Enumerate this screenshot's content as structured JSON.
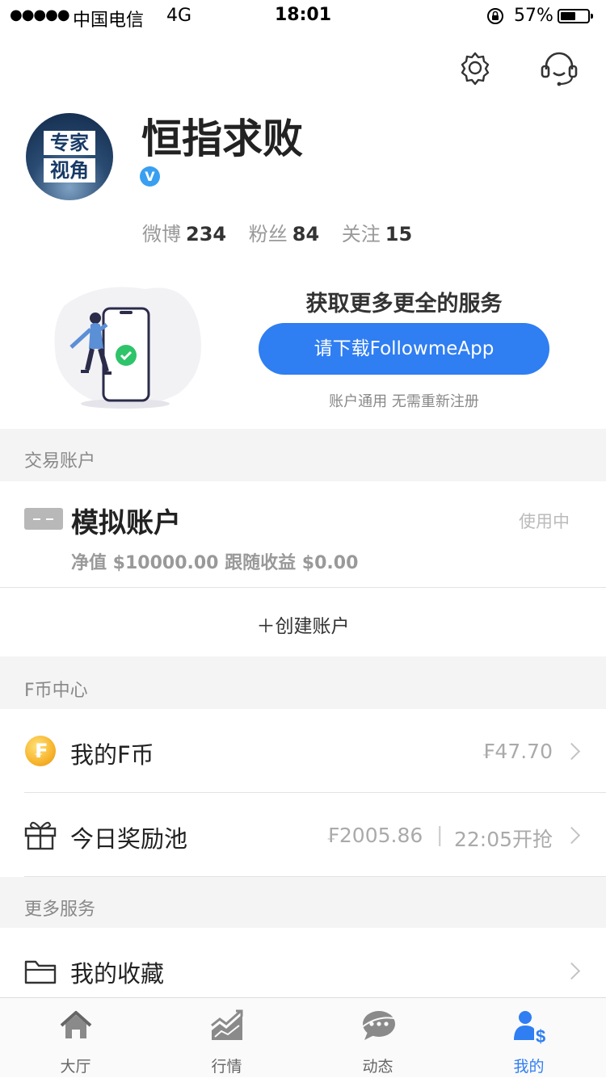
{
  "status_bar": {
    "signal": "●●●●●",
    "carrier": "中国电信",
    "network": "4G",
    "time": "18:01",
    "battery_percent": "57%",
    "battery_level": 0.57
  },
  "header_actions": {
    "settings_icon": "gear-icon",
    "support_icon": "headset-icon"
  },
  "profile": {
    "avatar_line1": "专家",
    "avatar_line2": "视角",
    "username": "恒指求败",
    "verified_badge": "V",
    "stats": [
      {
        "label": "微博",
        "value": "234"
      },
      {
        "label": "粉丝",
        "value": "84"
      },
      {
        "label": "关注",
        "value": "15"
      }
    ]
  },
  "promo": {
    "title": "获取更多更全的服务",
    "button_label": "请下载FollowmeApp",
    "note": "账户通用 无需重新注册"
  },
  "trading": {
    "section_title": "交易账户",
    "account_name": "模拟账户",
    "account_status": "使用中",
    "account_detail": "净值 $10000.00  跟随收益 $0.00",
    "create_label": "＋创建账户"
  },
  "fcoin": {
    "section_title": "F币中心",
    "coin_symbol": "₣",
    "my_coin_label": "我的F币",
    "my_coin_value": "₣47.70",
    "reward_label": "今日奖励池",
    "reward_value": "₣2005.86",
    "reward_separator": "|",
    "reward_time": "22:05开抢"
  },
  "more": {
    "section_title": "更多服务",
    "favorites_label": "我的收藏"
  },
  "tabbar": {
    "active_color": "#2f7ef2",
    "items": [
      {
        "label": "大厅",
        "icon": "home-icon"
      },
      {
        "label": "行情",
        "icon": "chart-icon"
      },
      {
        "label": "动态",
        "icon": "chat-bubble-icon"
      },
      {
        "label": "我的",
        "icon": "user-dollar-icon"
      }
    ]
  }
}
